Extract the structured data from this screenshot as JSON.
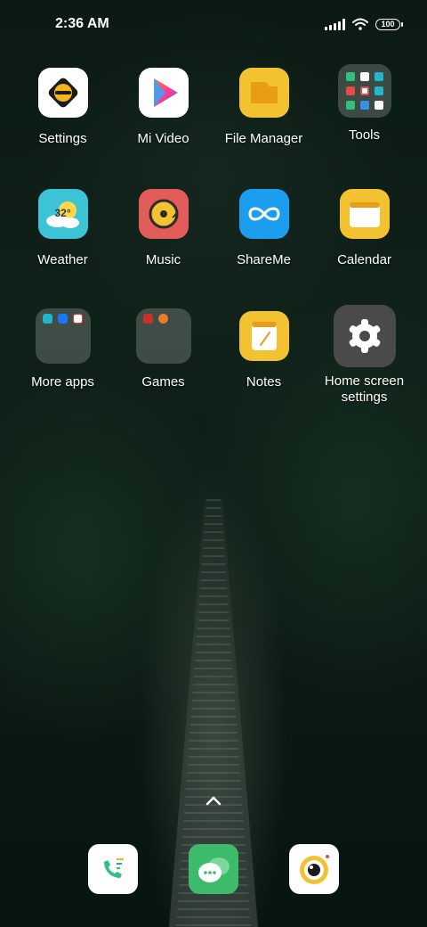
{
  "status_bar": {
    "time": "2:36 AM",
    "battery": "100"
  },
  "apps": [
    {
      "label": "Settings",
      "icon": "settings-icon"
    },
    {
      "label": "Mi Video",
      "icon": "play-icon"
    },
    {
      "label": "File Manager",
      "icon": "folder-icon"
    },
    {
      "label": "Tools",
      "icon": "tools-folder-icon"
    },
    {
      "label": "Weather",
      "icon": "weather-icon",
      "temp": "32°"
    },
    {
      "label": "Music",
      "icon": "music-disc-icon"
    },
    {
      "label": "ShareMe",
      "icon": "infinity-icon"
    },
    {
      "label": "Calendar",
      "icon": "calendar-icon"
    },
    {
      "label": "More apps",
      "icon": "more-apps-folder-icon"
    },
    {
      "label": "Games",
      "icon": "games-folder-icon"
    },
    {
      "label": "Notes",
      "icon": "notes-icon"
    },
    {
      "label": "Home screen settings",
      "icon": "gear-icon"
    }
  ],
  "dock": [
    {
      "icon": "phone-icon"
    },
    {
      "icon": "messages-icon"
    },
    {
      "icon": "camera-icon"
    }
  ],
  "colors": {
    "wallpaper": "#0f2119",
    "file_manager": "#f2c230",
    "weather": "#3cc3d6",
    "music": "#e25c5a",
    "shareme": "#1c9ef0",
    "calendar": "#f2c230",
    "notes": "#f2c230",
    "home_settings": "#4a4a4a",
    "messages": "#3dbb6a"
  }
}
